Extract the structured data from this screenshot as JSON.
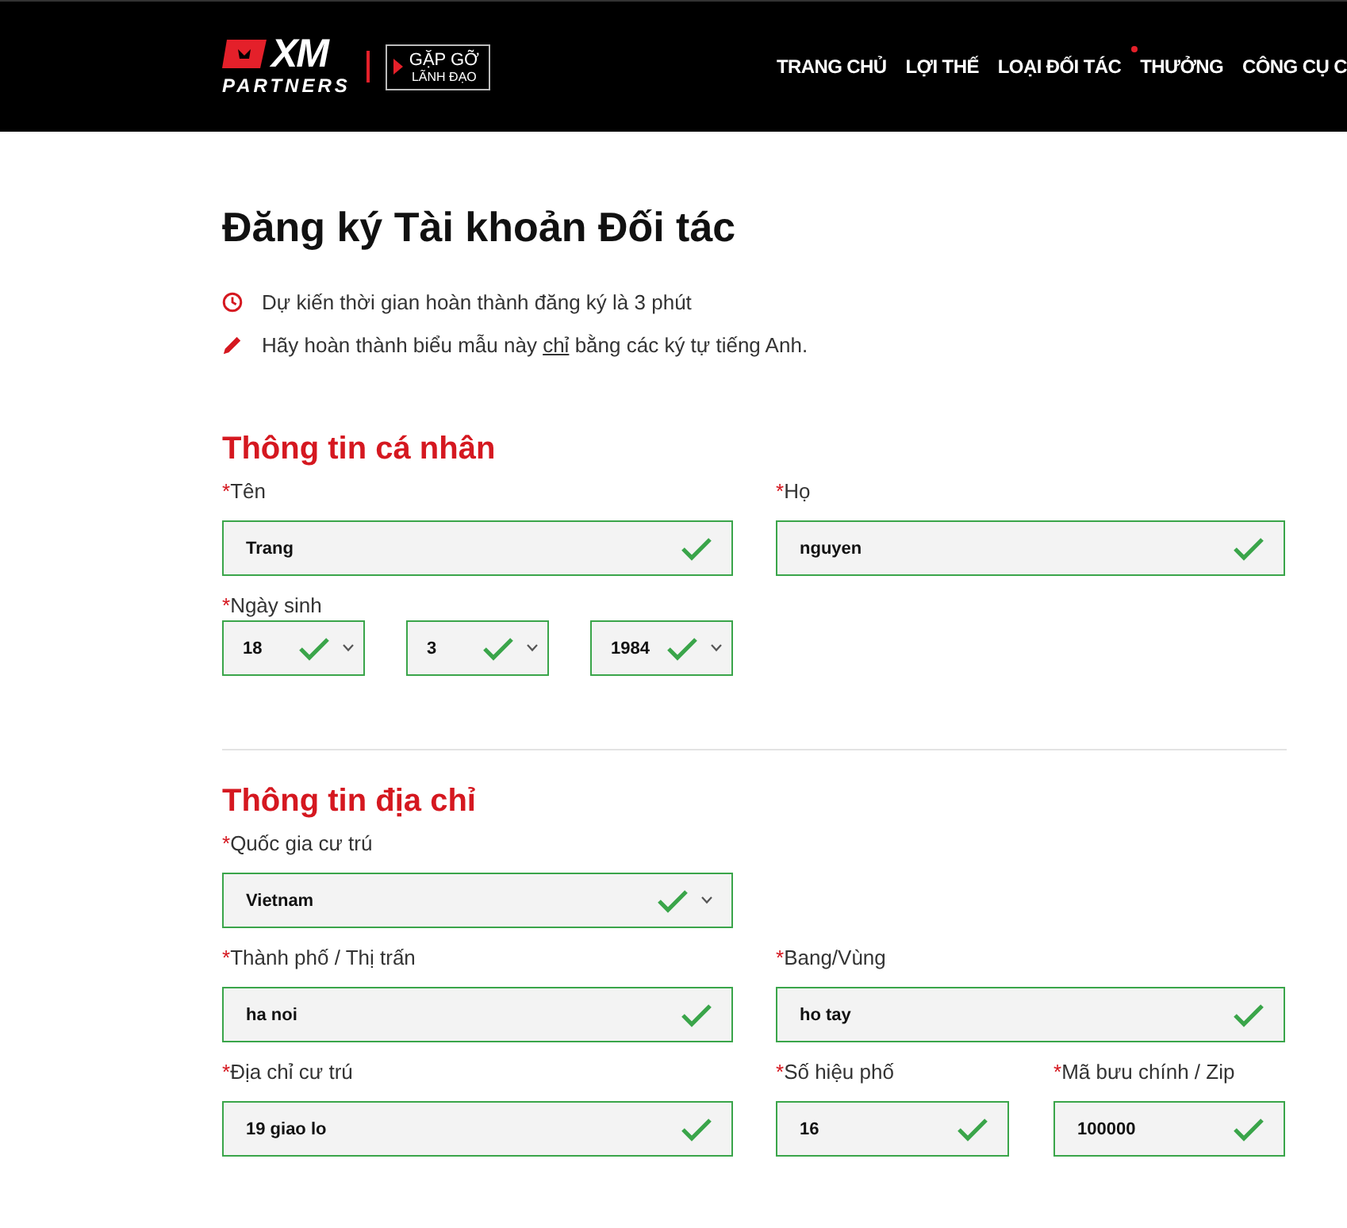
{
  "header": {
    "logo": {
      "mark": "XM",
      "sub": "PARTNERS"
    },
    "badge": {
      "line1": "GẶP GỠ",
      "line2": "LÃNH ĐẠO"
    },
    "nav": [
      {
        "label": "TRANG CHỦ",
        "dot": false
      },
      {
        "label": "LỢI THẾ",
        "dot": false
      },
      {
        "label": "LOẠI ĐỐI TÁC",
        "dot": false
      },
      {
        "label": "THƯỞNG",
        "dot": true
      },
      {
        "label": "CÔNG CỤ C",
        "dot": false
      }
    ]
  },
  "title": "Đăng ký Tài khoản Đối tác",
  "notes": [
    {
      "kind": "clock",
      "text": "Dự kiến thời gian hoàn thành đăng ký là 3 phút"
    },
    {
      "kind": "pencil",
      "text": "Hãy hoàn thành biểu mẫu này ",
      "underlined": "chỉ",
      "after": " bằng các ký tự tiếng Anh."
    }
  ],
  "sections": [
    {
      "title": "Thông tin cá nhân",
      "rows": [
        {
          "kind": "fields",
          "fields": [
            {
              "label": "Tên",
              "required": "*",
              "kind": "text",
              "value": "Trang",
              "valid": true
            },
            {
              "label": "Họ",
              "required": "*",
              "kind": "text",
              "value": "nguyen",
              "valid": true
            }
          ]
        },
        {
          "kind": "date",
          "label": "Ngày sinh",
          "required": "*",
          "fields": [
            {
              "kind": "select",
              "value": "18",
              "valid": true
            },
            {
              "kind": "select",
              "value": "3",
              "valid": true
            },
            {
              "kind": "select",
              "value": "1984",
              "valid": true
            }
          ]
        }
      ]
    },
    {
      "title": "Thông tin địa chỉ",
      "rows": [
        {
          "kind": "fields",
          "fields": [
            {
              "label": "Quốc gia cư trú",
              "required": "*",
              "kind": "select",
              "value": "Vietnam",
              "valid": true
            }
          ]
        },
        {
          "kind": "fields",
          "fields": [
            {
              "label": "Thành phố / Thị trấn",
              "required": "*",
              "kind": "text",
              "value": "ha noi",
              "valid": true
            },
            {
              "label": "Bang/Vùng",
              "required": "*",
              "kind": "text",
              "value": "ho tay",
              "valid": true
            }
          ]
        },
        {
          "kind": "fields",
          "fields": [
            {
              "label": "Địa chỉ cư trú",
              "required": "*",
              "kind": "text",
              "value": "19 giao lo",
              "valid": true
            },
            {
              "label": "Số hiệu phố",
              "required": "*",
              "kind": "text",
              "value": "16",
              "valid": true
            },
            {
              "label": "Mã bưu chính / Zip",
              "required": "*",
              "kind": "text",
              "value": "100000",
              "valid": true
            }
          ]
        }
      ]
    }
  ]
}
